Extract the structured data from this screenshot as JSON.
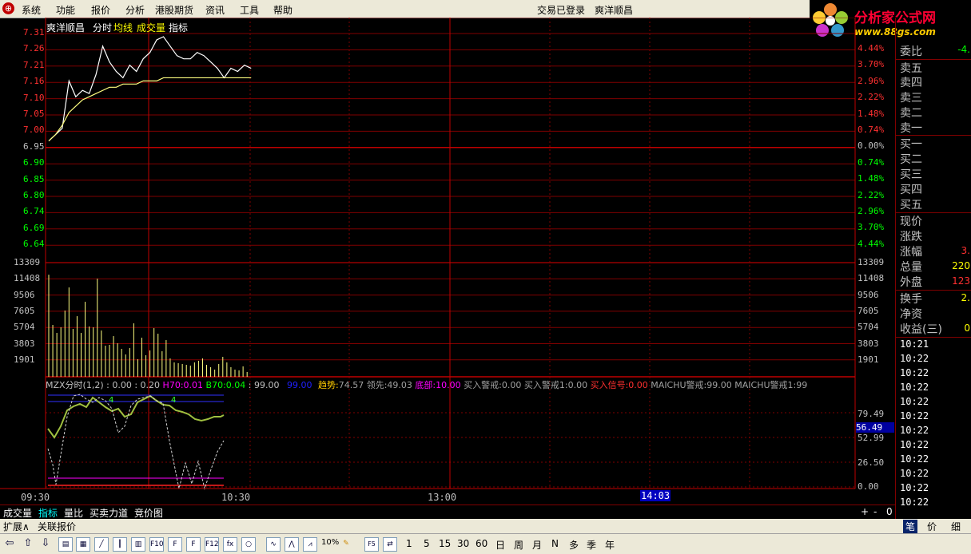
{
  "menu": {
    "items": [
      "系统",
      "功能",
      "报价",
      "分析",
      "港股期货",
      "资讯",
      "工具",
      "帮助"
    ],
    "status": "交易已登录",
    "stock": "爽洋顺昌"
  },
  "logo": {
    "title": "分析家公式网",
    "url": "www.88gs.com"
  },
  "header": {
    "stock": "爽洋顺昌",
    "tabs": [
      "分时",
      "均线",
      "成交量",
      "指标"
    ]
  },
  "price_axis": {
    "left": [
      "7.31",
      "7.26",
      "7.21",
      "7.16",
      "7.10",
      "7.05",
      "7.00",
      "6.95",
      "6.90",
      "6.85",
      "6.80",
      "6.74",
      "6.69",
      "6.64"
    ],
    "right": [
      "4.44%",
      "3.70%",
      "2.96%",
      "2.22%",
      "1.48%",
      "0.74%",
      "0.00%",
      "0.74%",
      "1.48%",
      "2.22%",
      "2.96%",
      "3.70%",
      "4.44%"
    ]
  },
  "volume_axis": [
    "13309",
    "11408",
    "9506",
    "7605",
    "5704",
    "3803",
    "1901"
  ],
  "indicator": {
    "name": "MZX分时(1,2)",
    "v1": ": 0.00",
    "v2": ": 0.20",
    "h70_label": "H70:",
    "h70": "0.01",
    "b70_label": "B70:",
    "b70": "0.04",
    "v3": ": 99.00",
    "v4": "99.00",
    "trend_label": "趋势:",
    "trend": "74.57",
    "lead_label": "领先:",
    "lead": "49.03",
    "bottom_label": "底部:",
    "bottom": "10.00",
    "buy_warn_label": "买入警戒:",
    "buy_warn": "0.00",
    "buy_warn1_label": "买入警戒1:",
    "buy_warn1": "0.00",
    "buy_signal_label": "买入信号:",
    "buy_signal": "0.00",
    "maichu_label": "MAICHU警戒:",
    "maichu": "99.00",
    "maichu1_label": "MAICHU警戒1:",
    "maichu1": "99",
    "axis": [
      "79.49",
      "52.99",
      "26.50",
      "0.00"
    ],
    "highlight": "56.49"
  },
  "time_axis": [
    "09:30",
    "10:30",
    "13:00",
    "14:03"
  ],
  "right_panel": {
    "wei_bi_label": "委比",
    "wei_bi": "-4.",
    "sells": [
      "卖五",
      "卖四",
      "卖三",
      "卖二",
      "卖一"
    ],
    "buys": [
      "买一",
      "买二",
      "买三",
      "买四",
      "买五"
    ],
    "stats_labels": [
      "现价",
      "涨跌",
      "涨幅",
      "总量",
      "外盘"
    ],
    "stats_values": [
      "",
      "",
      "3.",
      "220",
      "123"
    ],
    "stats2_labels": [
      "换手",
      "净资",
      "收益(三)"
    ],
    "stats2_values": [
      "2.",
      "",
      "0"
    ],
    "ticks": [
      "10:21",
      "10:22",
      "10:22",
      "10:22",
      "10:22",
      "10:22",
      "10:22",
      "10:22",
      "10:22",
      "10:22",
      "10:22",
      "10:22"
    ],
    "bottom_tabs": [
      "笔",
      "价",
      "细"
    ]
  },
  "bottom_tabs": {
    "tabs": [
      "成交量",
      "指标",
      "量比",
      "买卖力道",
      "竞价图"
    ],
    "controls": [
      "+",
      "-",
      "0"
    ],
    "row2": [
      "扩展∧",
      "关联报价"
    ]
  },
  "toolbar": {
    "periods": [
      "1",
      "5",
      "15",
      "30",
      "60",
      "日",
      "周",
      "月",
      "N",
      "多",
      "季",
      "年"
    ],
    "zoom": "10%",
    "f5": "F5"
  },
  "chart_data": {
    "type": "line",
    "title": "",
    "price_series": {
      "name": "",
      "x_minutes": [
        0,
        2,
        4,
        6,
        8,
        10,
        12,
        14,
        16,
        18,
        20,
        22,
        24,
        26,
        28,
        30,
        32,
        34,
        36,
        38,
        40,
        42,
        44,
        46,
        48,
        50,
        52,
        54,
        56,
        58,
        60
      ],
      "values": [
        6.97,
        6.99,
        7.01,
        7.16,
        7.11,
        7.13,
        7.12,
        7.18,
        7.27,
        7.22,
        7.19,
        7.17,
        7.21,
        7.19,
        7.23,
        7.25,
        7.29,
        7.3,
        7.27,
        7.24,
        7.23,
        7.23,
        7.25,
        7.24,
        7.22,
        7.2,
        7.17,
        7.2,
        7.19,
        7.21,
        7.2
      ]
    },
    "avg_series": {
      "name": "",
      "values": [
        6.97,
        6.99,
        7.02,
        7.06,
        7.08,
        7.1,
        7.11,
        7.12,
        7.13,
        7.14,
        7.14,
        7.15,
        7.15,
        7.15,
        7.16,
        7.16,
        7.16,
        7.17,
        7.17,
        7.17,
        7.17,
        7.17,
        7.17,
        7.17,
        7.17,
        7.17,
        7.17,
        7.17,
        7.17,
        7.17,
        7.17
      ]
    },
    "volume": [
      12800,
      6500,
      5500,
      6200,
      8300,
      11200,
      6000,
      7600,
      5500,
      9400,
      6300,
      6200,
      12300,
      5800,
      3900,
      4000,
      5100,
      4200,
      3500,
      2800,
      3600,
      6700,
      2200,
      4900,
      2700,
      3300,
      6100,
      5400,
      3200,
      4600,
      2300,
      1800,
      1700,
      1600,
      1500,
      1400,
      1800,
      2000,
      2300,
      1500,
      1200,
      900,
      1600,
      2500,
      1800,
      1200,
      900,
      800,
      1300,
      600
    ],
    "price_ylim": [
      6.64,
      7.31
    ],
    "volume_ylim": [
      0,
      13309
    ],
    "x_range_minutes": [
      0,
      240
    ]
  }
}
